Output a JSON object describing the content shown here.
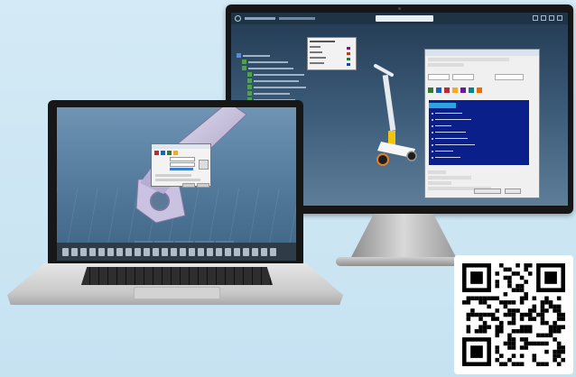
{
  "monitor_app": {
    "search_placeholder": "",
    "popup_items": [
      "",
      "",
      "",
      ""
    ],
    "popup_colors": [
      "#6b1f7a",
      "#c0392b",
      "#1f7a3a",
      "#1f3f9e"
    ],
    "dialog_title": "",
    "dialog_list_selected": "",
    "buttons": [
      "",
      ""
    ]
  },
  "laptop_app": {
    "dialog_title": ""
  },
  "icons": {
    "qr": "qr-code-icon",
    "monitor_logo": "compass-logo-icon"
  },
  "colors": {
    "background": "#cde6f4",
    "list_highlight": "#0b1f8a",
    "list_selection": "#2aa3df",
    "tree_node": "#4fa14f"
  }
}
